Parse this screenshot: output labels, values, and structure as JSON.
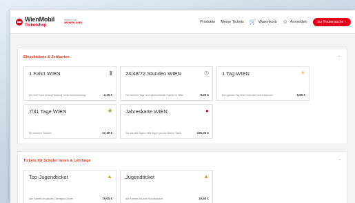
{
  "header": {
    "brand_main": "WienMobil",
    "brand_sub": "Ticketshop",
    "partner_top": "Bedient von",
    "partner_bottom": "WIENER LINIEN",
    "nav": [
      {
        "label": "Produkte",
        "icon": ""
      },
      {
        "label": "Meine Tickets",
        "icon": ""
      },
      {
        "label": "Warenkorb",
        "icon": "cart-icon"
      },
      {
        "label": "Anmelden",
        "icon": "user-icon"
      }
    ],
    "route_button": "zur Routensuche"
  },
  "sections": [
    {
      "title": "Einzeltickets & Zeitkarten",
      "cards": [
        {
          "title": "1 Fahrt WIEN",
          "desc": "Für eine Fahrt in eine Richtung, ohne Unterbrechung",
          "price": "2,20 €",
          "icon": "ticket-icon",
          "icon_color": "#8a8a8a"
        },
        {
          "title": "24/48/72 Stunden WIEN",
          "desc": "Für mehrere Tage und unbeschränkte Fahrten in Wien",
          "price": "8,00 €",
          "icon": "clock-icon",
          "icon_color": "#9a9a9a"
        },
        {
          "title": "1 Tag WIEN",
          "desc": "Den ganzen Tag Wien erkunden und entdecken",
          "price": "5,80 €",
          "icon": "sun-icon",
          "icon_color": "#e1b21c"
        },
        {
          "title": "7/31 Tage WIEN",
          "desc": "Für mehrere Wochen",
          "price": "17,10 €",
          "icon": "calendar-icon",
          "icon_color": "#7fa53c"
        },
        {
          "title": "Jahreskarte WIEN",
          "desc": "Nur mit 365 Tagen / 365 Tagen um die Wiener Stadt",
          "price": "235,00 €",
          "icon": "jahreskarte-icon",
          "icon_color": "#d6001c"
        }
      ]
    },
    {
      "title": "Tickets für Schüler:innen & Lehrlinge",
      "cards": [
        {
          "title": "Top-Jugendticket",
          "desc": "Alle Fahrten im ganzen Ostregion-Gebiet",
          "price": "79,00 €",
          "icon": "student-icon",
          "icon_color": "#d4a319"
        },
        {
          "title": "Jugendticket",
          "desc": "Alle Fahrten bis zum Schulstandort",
          "price": "19,60 €",
          "icon": "student-icon",
          "icon_color": "#d99a1a"
        }
      ]
    }
  ]
}
